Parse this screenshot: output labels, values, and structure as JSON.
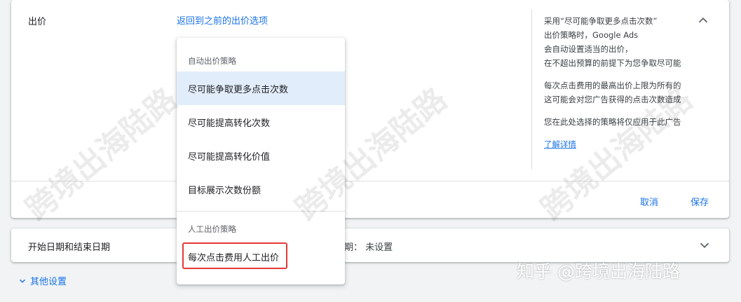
{
  "bid_section": {
    "label": "出价",
    "back_link": "返回到之前的出价选项",
    "help": {
      "lines1": [
        "采用“尽可能争取更多点击次数”",
        "出价策略时，Google Ads",
        "会自动设置适当的出价，",
        "在不超出预算的前提下为您争取尽可能"
      ],
      "lines2": [
        "每次点击费用的最高出价上限为所有的",
        "这可能会对您广告获得的点击次数造成"
      ],
      "lines3": [
        "您在此处选择的策略将仅应用于此广告"
      ],
      "learn_more": "了解详情"
    },
    "cancel": "取消",
    "save": "保存"
  },
  "dropdown": {
    "auto_header": "自动出价策略",
    "auto_items": [
      "尽可能争取更多点击次数",
      "尽可能提高转化次数",
      "尽可能提高转化价值",
      "目标展示次数份额"
    ],
    "selected_index": 0,
    "manual_header": "人工出价策略",
    "manual_items": [
      "每次点击费用人工出价"
    ]
  },
  "date_section": {
    "label": "开始日期和结束日期",
    "end_date_text": "期： 未设置"
  },
  "other_settings": "其他设置",
  "watermarks": [
    "跨境出海陆路",
    "跨境出海陆路",
    "跨境出海陆路"
  ],
  "footer_watermark": "知乎 @跨境出海陆路",
  "colors": {
    "link": "#1a73e8",
    "selected_bg": "#e2edfb",
    "highlight": "#e53935"
  }
}
